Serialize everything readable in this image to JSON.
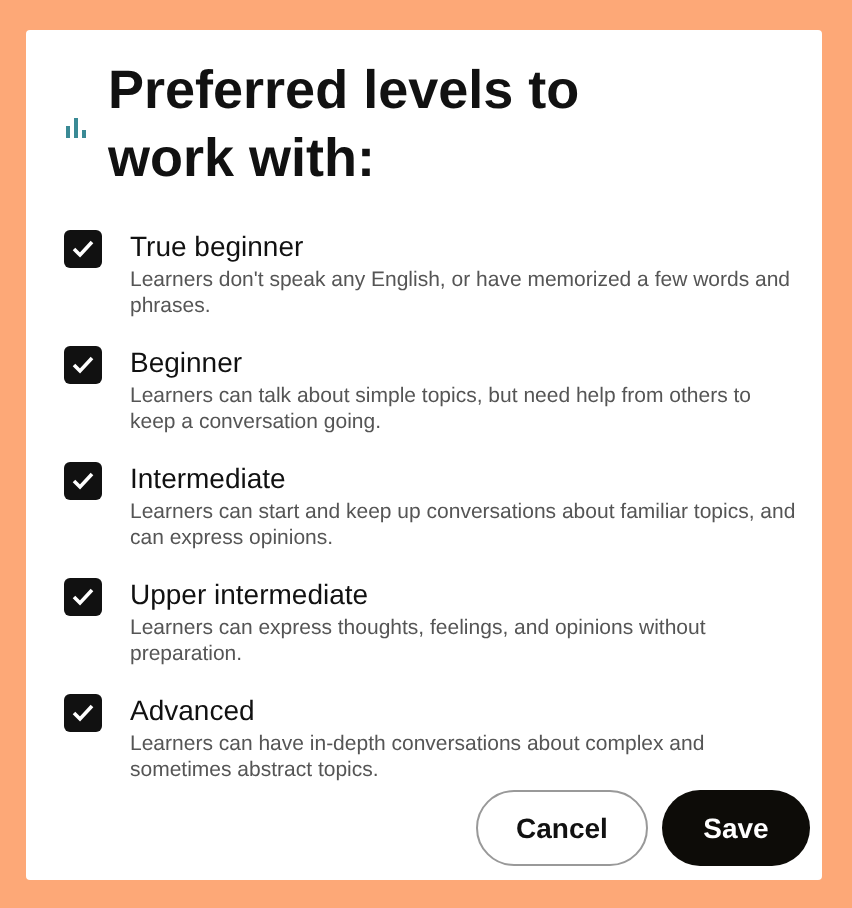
{
  "dialog": {
    "title": "Preferred levels to work with:",
    "levels": [
      {
        "label": "True beginner",
        "description": "Learners don't speak any English, or have memorized a few words and phrases.",
        "checked": true
      },
      {
        "label": "Beginner",
        "description": "Learners can talk about simple topics, but need help from others to keep a conversation going.",
        "checked": true
      },
      {
        "label": "Intermediate",
        "description": "Learners can start and keep up conversations about familiar topics, and can express opinions.",
        "checked": true
      },
      {
        "label": "Upper intermediate",
        "description": "Learners can express thoughts, feelings, and opinions without preparation.",
        "checked": true
      },
      {
        "label": "Advanced",
        "description": "Learners can have in-depth conversations about complex and sometimes abstract topics.",
        "checked": true
      }
    ],
    "buttons": [
      {
        "label": "Cancel",
        "kind": "secondary"
      },
      {
        "label": "Save",
        "kind": "primary"
      }
    ]
  }
}
